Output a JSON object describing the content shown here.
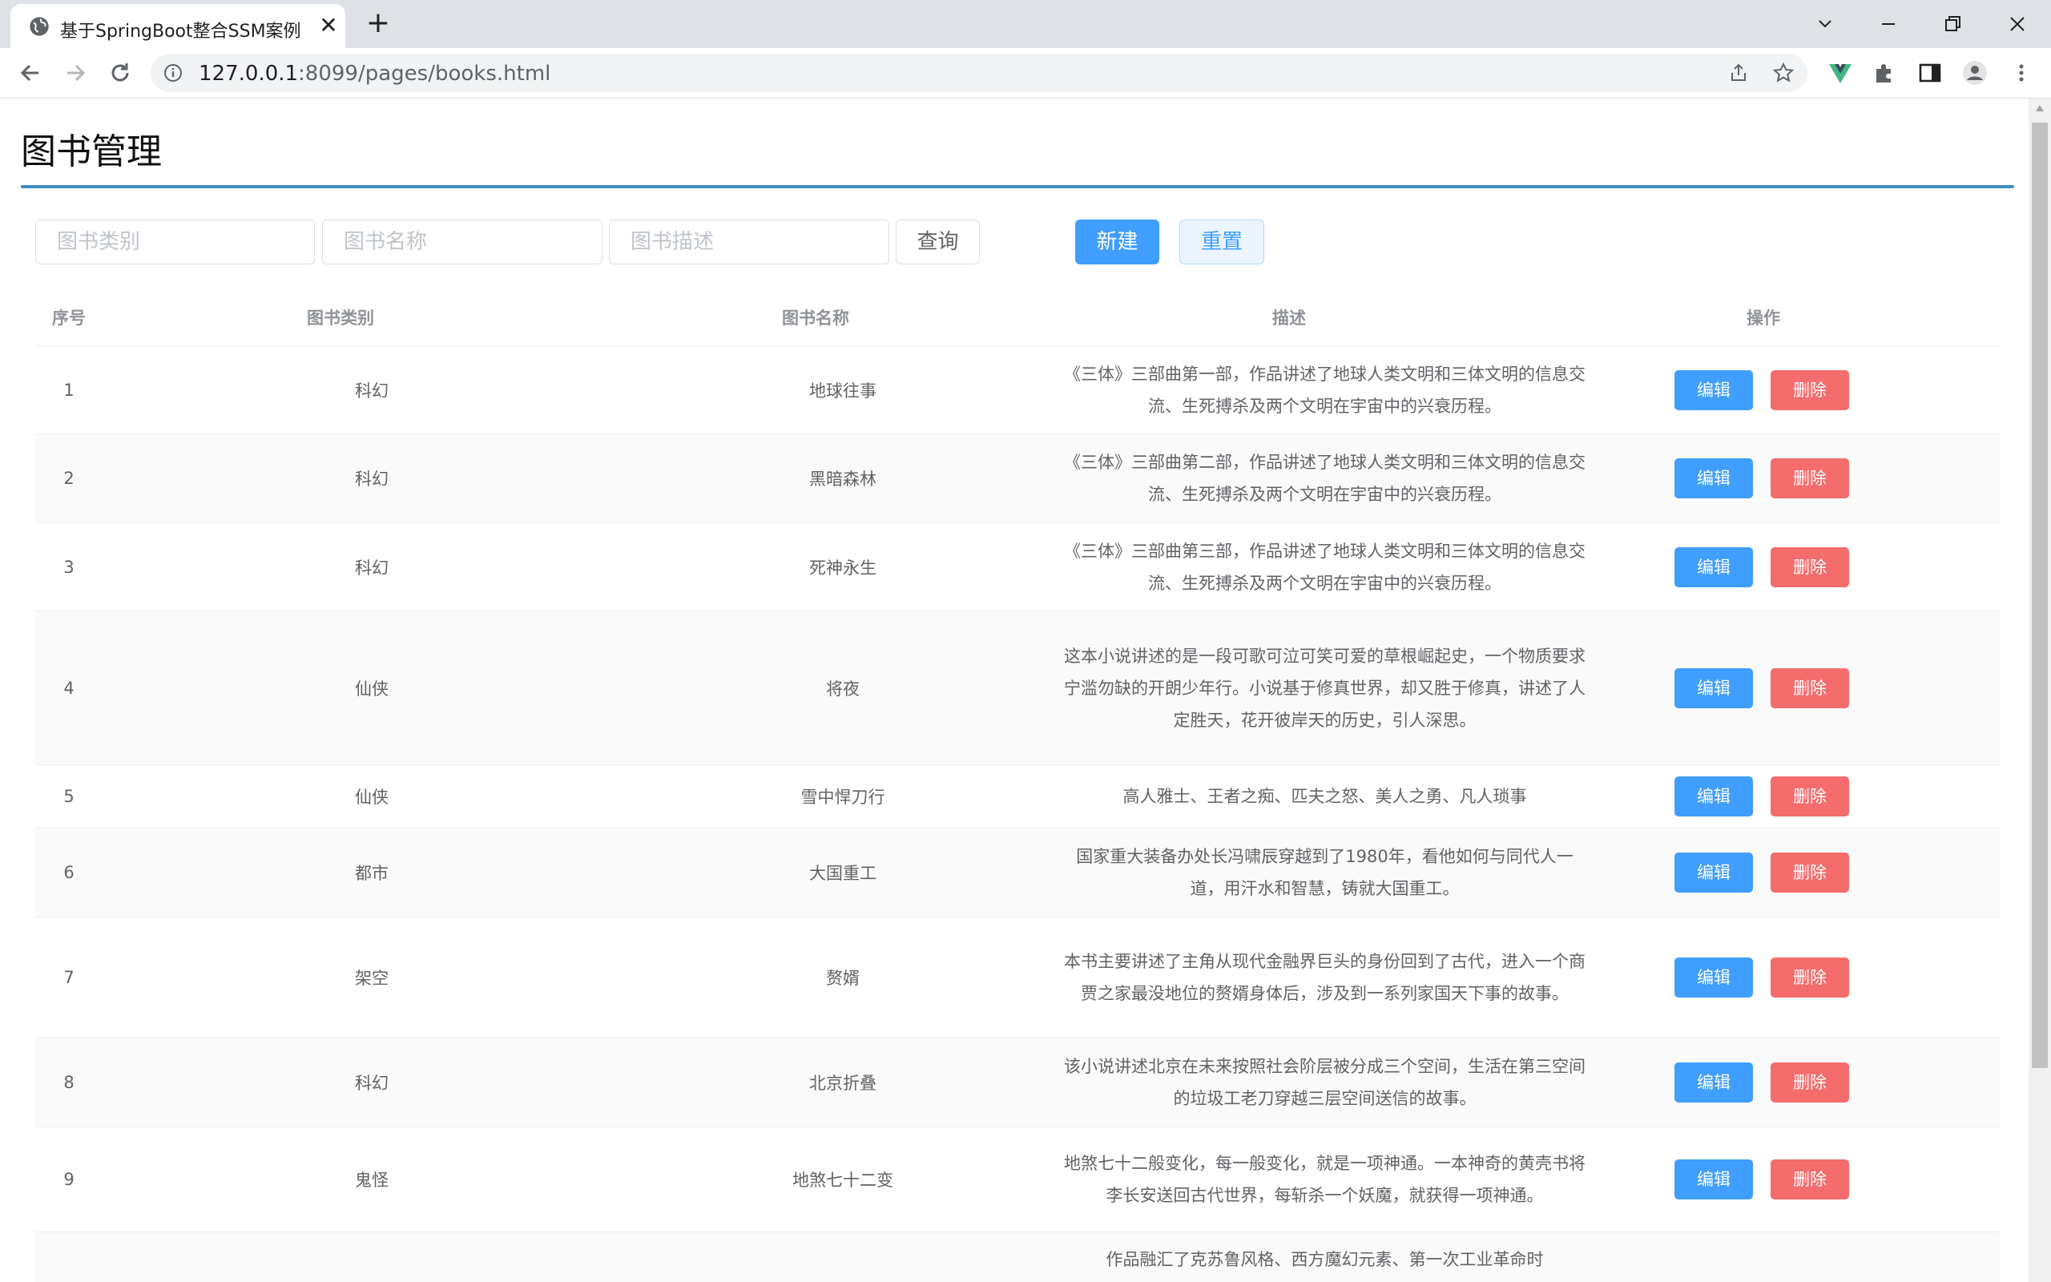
{
  "browser": {
    "tab_title": "基于SpringBoot整合SSM案例",
    "url_host": "127.0.0.1",
    "url_rest": ":8099/pages/books.html"
  },
  "page": {
    "title": "图书管理",
    "search": {
      "type_placeholder": "图书类别",
      "name_placeholder": "图书名称",
      "desc_placeholder": "图书描述"
    },
    "buttons": {
      "query": "查询",
      "new": "新建",
      "reset": "重置"
    },
    "table": {
      "headers": {
        "index": "序号",
        "type": "图书类别",
        "name": "图书名称",
        "desc": "描述",
        "actions": "操作"
      },
      "edit_label": "编辑",
      "delete_label": "删除",
      "rows": [
        {
          "index": "1",
          "type": "科幻",
          "name": "地球往事",
          "desc": "《三体》三部曲第一部，作品讲述了地球人类文明和三体文明的信息交流、生死搏杀及两个文明在宇宙中的兴衰历程。"
        },
        {
          "index": "2",
          "type": "科幻",
          "name": "黑暗森林",
          "desc": "《三体》三部曲第二部，作品讲述了地球人类文明和三体文明的信息交流、生死搏杀及两个文明在宇宙中的兴衰历程。"
        },
        {
          "index": "3",
          "type": "科幻",
          "name": "死神永生",
          "desc": "《三体》三部曲第三部，作品讲述了地球人类文明和三体文明的信息交流、生死搏杀及两个文明在宇宙中的兴衰历程。"
        },
        {
          "index": "4",
          "type": "仙侠",
          "name": "将夜",
          "desc": "这本小说讲述的是一段可歌可泣可笑可爱的草根崛起史，一个物质要求宁滥勿缺的开朗少年行。小说基于修真世界，却又胜于修真，讲述了人定胜天，花开彼岸天的历史，引人深思。"
        },
        {
          "index": "5",
          "type": "仙侠",
          "name": "雪中悍刀行",
          "desc": "高人雅士、王者之痴、匹夫之怒、美人之勇、凡人琐事"
        },
        {
          "index": "6",
          "type": "都市",
          "name": "大国重工",
          "desc": "国家重大装备办处长冯啸辰穿越到了1980年，看他如何与同代人一道，用汗水和智慧，铸就大国重工。"
        },
        {
          "index": "7",
          "type": "架空",
          "name": "赘婿",
          "desc": "本书主要讲述了主角从现代金融界巨头的身份回到了古代，进入一个商贾之家最没地位的赘婿身体后，涉及到一系列家国天下事的故事。"
        },
        {
          "index": "8",
          "type": "科幻",
          "name": "北京折叠",
          "desc": "该小说讲述北京在未来按照社会阶层被分成三个空间，生活在第三空间的垃圾工老刀穿越三层空间送信的故事。"
        },
        {
          "index": "9",
          "type": "鬼怪",
          "name": "地煞七十二变",
          "desc": "地煞七十二般变化，每一般变化，就是一项神通。一本神奇的黄壳书将李长安送回古代世界，每斩杀一个妖魔，就获得一项神通。"
        },
        {
          "index": "",
          "type": "",
          "name": "",
          "desc": "作品融汇了克苏鲁风格、西方魔幻元素、第一次工业革命时"
        }
      ]
    }
  }
}
